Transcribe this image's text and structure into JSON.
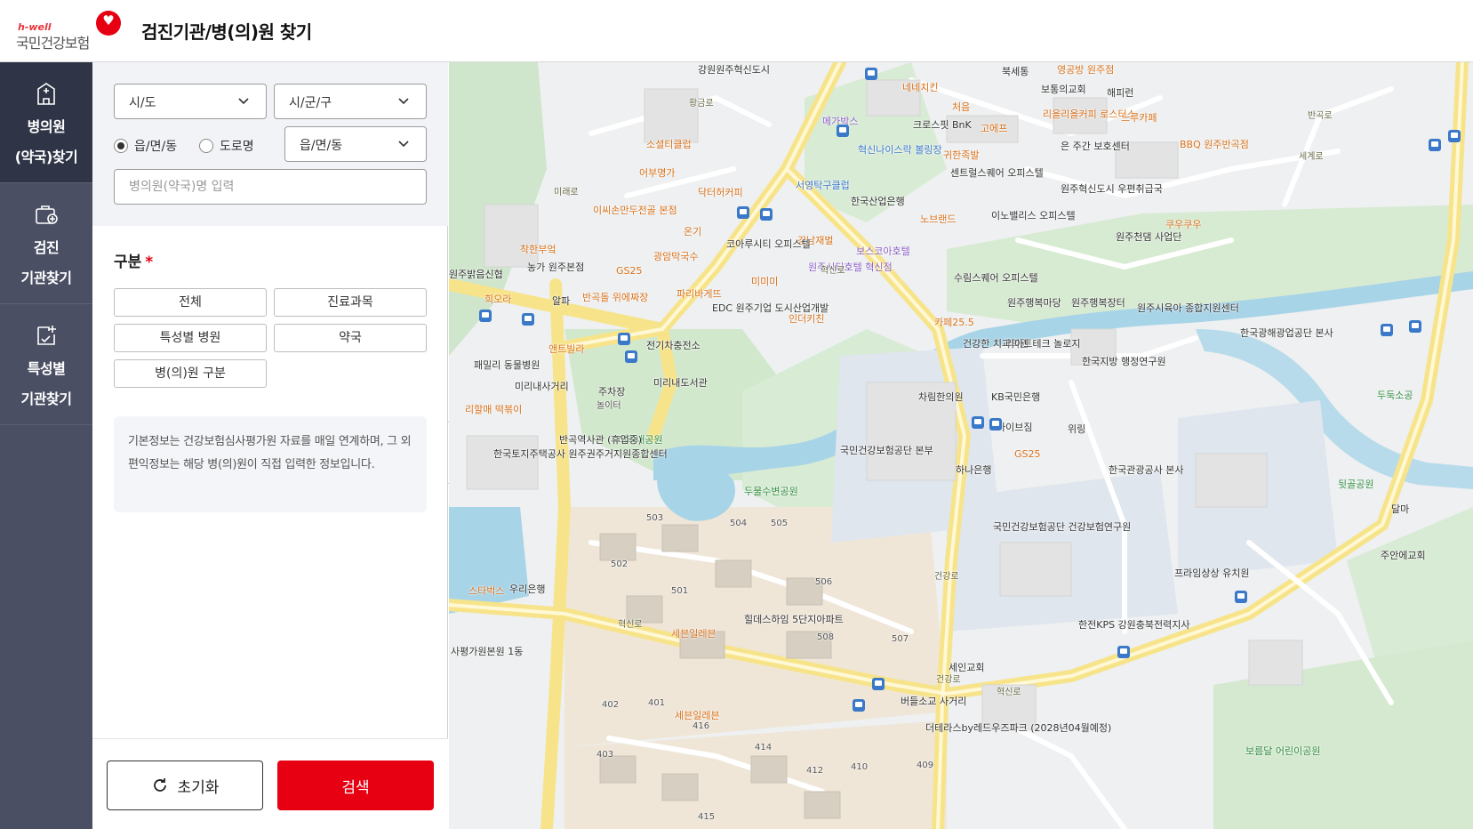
{
  "header": {
    "logo_small": "h-well",
    "logo_brand": "국민건강보험",
    "title": "검진기관/병(의)원 찾기"
  },
  "nav": {
    "items": [
      {
        "label": "병의원\n(약국)찾기",
        "icon": "hospital-icon",
        "active": true
      },
      {
        "label": "검진\n기관찾기",
        "icon": "medical-bag-icon",
        "active": false
      },
      {
        "label": "특성별\n기관찾기",
        "icon": "clipboard-plus-icon",
        "active": false
      }
    ]
  },
  "filters": {
    "sido": "시/도",
    "sigungu": "시/군/구",
    "radio_dong": "읍/면/동",
    "radio_road": "도로명",
    "dong_select": "읍/면/동",
    "name_placeholder": "병의원(약국)명 입력"
  },
  "category": {
    "title": "구분",
    "required_mark": "*",
    "buttons": [
      "전체",
      "진료과목",
      "특성별 병원",
      "약국",
      "병(의)원 구분"
    ]
  },
  "info_text": "기본정보는 건강보험심사평가원 자료를 매일 연계하며, 그 외 편익정보는 해당 병(의)원이 직접 입력한 정보입니다.",
  "actions": {
    "reset": "초기화",
    "search": "검색"
  },
  "map": {
    "labels": [
      {
        "t": "강원원주혁신도시",
        "c": "poi"
      },
      {
        "t": "북세통",
        "c": "poi"
      },
      {
        "t": "영공방 원주점",
        "c": "poi orange"
      },
      {
        "t": "보통의교회",
        "c": "poi"
      },
      {
        "t": "해피런",
        "c": "poi"
      },
      {
        "t": "네네치킨",
        "c": "poi orange"
      },
      {
        "t": "처음",
        "c": "poi orange"
      },
      {
        "t": "메가박스",
        "c": "poi purple"
      },
      {
        "t": "크로스핏 BnK",
        "c": "poi"
      },
      {
        "t": "고에프",
        "c": "poi orange"
      },
      {
        "t": "리을리을커피 로스터스",
        "c": "poi orange"
      },
      {
        "t": "느루카페",
        "c": "poi orange"
      },
      {
        "t": "BBQ 원주반곡점",
        "c": "poi orange"
      },
      {
        "t": "소셜티클럽",
        "c": "poi orange"
      },
      {
        "t": "혁신나이스락 볼링장",
        "c": "poi blue"
      },
      {
        "t": "귀한족발",
        "c": "poi orange"
      },
      {
        "t": "은 주간 보호센터",
        "c": "poi"
      },
      {
        "t": "어부명가",
        "c": "poi orange"
      },
      {
        "t": "닥터허커피",
        "c": "poi orange"
      },
      {
        "t": "서영탁구클럽",
        "c": "poi blue"
      },
      {
        "t": "센트럴스퀘어 오피스텔",
        "c": "poi"
      },
      {
        "t": "원주혁신도시 우편취급국",
        "c": "poi"
      },
      {
        "t": "이씨손만두전골 본점",
        "c": "poi orange"
      },
      {
        "t": "한국산업은행",
        "c": "poi"
      },
      {
        "t": "노브랜드",
        "c": "poi orange"
      },
      {
        "t": "이노밸리스 오피스텔",
        "c": "poi"
      },
      {
        "t": "쿠우쿠우",
        "c": "poi orange"
      },
      {
        "t": "온기",
        "c": "poi orange"
      },
      {
        "t": "강남재벌",
        "c": "poi orange"
      },
      {
        "t": "원주천댐 사업단",
        "c": "poi"
      },
      {
        "t": "착한부엌",
        "c": "poi orange"
      },
      {
        "t": "코아루시티 오피스텔",
        "c": "poi"
      },
      {
        "t": "보스코아호텔",
        "c": "poi purple"
      },
      {
        "t": "광암막국수",
        "c": "poi orange"
      },
      {
        "t": "원주시티호텔 혁신점",
        "c": "poi purple"
      },
      {
        "t": "원주밝음신협",
        "c": "poi"
      },
      {
        "t": "농가 원주본점",
        "c": "poi"
      },
      {
        "t": "GS25",
        "c": "poi orange"
      },
      {
        "t": "미미미",
        "c": "poi orange"
      },
      {
        "t": "수림스퀘어 오피스텔",
        "c": "poi"
      },
      {
        "t": "희오라",
        "c": "poi orange"
      },
      {
        "t": "알파",
        "c": "poi"
      },
      {
        "t": "반곡돌 위에짜장",
        "c": "poi orange"
      },
      {
        "t": "파리바게뜨",
        "c": "poi orange"
      },
      {
        "t": "원주행복마당",
        "c": "poi"
      },
      {
        "t": "원주행복장터",
        "c": "poi"
      },
      {
        "t": "원주시육아 종합지원센터",
        "c": "poi"
      },
      {
        "t": "EDC 원주기업 도시산업개발",
        "c": "poi"
      },
      {
        "t": "인더키친",
        "c": "poi orange"
      },
      {
        "t": "카페25.5",
        "c": "poi orange"
      },
      {
        "t": "한국광해광업공단 본사",
        "c": "poi"
      },
      {
        "t": "앤트빌라",
        "c": "poi orange"
      },
      {
        "t": "전기차충전소",
        "c": "poi"
      },
      {
        "t": "건강한 치과의원",
        "c": "poi"
      },
      {
        "t": "리아트테크 놀로지",
        "c": "poi"
      },
      {
        "t": "한국지방 행정연구원",
        "c": "poi"
      },
      {
        "t": "패밀리 동물병원",
        "c": "poi"
      },
      {
        "t": "미리내사거리",
        "c": "poi"
      },
      {
        "t": "주차장",
        "c": "poi"
      },
      {
        "t": "미리내도서관",
        "c": "poi"
      },
      {
        "t": "놀이터",
        "c": "poi num"
      },
      {
        "t": "차림한의원",
        "c": "poi"
      },
      {
        "t": "KB국민은행",
        "c": "poi"
      },
      {
        "t": "두둑소공",
        "c": "poi green"
      },
      {
        "t": "리할매 떡볶이",
        "c": "poi orange"
      },
      {
        "t": "바이브짐",
        "c": "poi"
      },
      {
        "t": "위링",
        "c": "poi"
      },
      {
        "t": "미리내공원",
        "c": "poi green"
      },
      {
        "t": "반곡역사관 (휴업중)",
        "c": "poi"
      },
      {
        "t": "국민건강보험공단 본부",
        "c": "poi"
      },
      {
        "t": "GS25",
        "c": "poi orange"
      },
      {
        "t": "한국토지주택공사 원주권주거지원종합센터",
        "c": "poi"
      },
      {
        "t": "하나은행",
        "c": "poi"
      },
      {
        "t": "한국관광공사 본사",
        "c": "poi"
      },
      {
        "t": "뒷골공원",
        "c": "poi green"
      },
      {
        "t": "두물수변공원",
        "c": "poi green"
      },
      {
        "t": "달마",
        "c": "poi"
      },
      {
        "t": "503",
        "c": "poi num"
      },
      {
        "t": "504",
        "c": "poi num"
      },
      {
        "t": "505",
        "c": "poi num"
      },
      {
        "t": "국민건강보험공단 건강보험연구원",
        "c": "poi"
      },
      {
        "t": "주안에교회",
        "c": "poi"
      },
      {
        "t": "502",
        "c": "poi num"
      },
      {
        "t": "506",
        "c": "poi num"
      },
      {
        "t": "프라임상상 유치원",
        "c": "poi"
      },
      {
        "t": "스타벅스",
        "c": "poi orange"
      },
      {
        "t": "우리은행",
        "c": "poi"
      },
      {
        "t": "501",
        "c": "poi num"
      },
      {
        "t": "힐데스하임 5단지아파트",
        "c": "poi"
      },
      {
        "t": "한전KPS 강원충북전력지사",
        "c": "poi"
      },
      {
        "t": "세븐일레븐",
        "c": "poi orange"
      },
      {
        "t": "508",
        "c": "poi num"
      },
      {
        "t": "507",
        "c": "poi num"
      },
      {
        "t": "사평가원본원 1동",
        "c": "poi"
      },
      {
        "t": "세인교회",
        "c": "poi"
      },
      {
        "t": "402",
        "c": "poi num"
      },
      {
        "t": "401",
        "c": "poi num"
      },
      {
        "t": "세븐일레븐",
        "c": "poi orange"
      },
      {
        "t": "416",
        "c": "poi num"
      },
      {
        "t": "버들소교 사거리",
        "c": "poi"
      },
      {
        "t": "더테라스by레드우즈파크 (2028년04월예정)",
        "c": "poi"
      },
      {
        "t": "414",
        "c": "poi num"
      },
      {
        "t": "403",
        "c": "poi num"
      },
      {
        "t": "412",
        "c": "poi num"
      },
      {
        "t": "410",
        "c": "poi num"
      },
      {
        "t": "409",
        "c": "poi num"
      },
      {
        "t": "보름달 어린이공원",
        "c": "poi green"
      },
      {
        "t": "415",
        "c": "poi num"
      },
      {
        "t": "혁신로",
        "c": "poi road"
      },
      {
        "t": "혁신로",
        "c": "poi road"
      },
      {
        "t": "혁신로",
        "c": "poi road"
      },
      {
        "t": "건강로",
        "c": "poi road"
      },
      {
        "t": "건강로",
        "c": "poi road"
      },
      {
        "t": "황금로",
        "c": "poi road"
      },
      {
        "t": "세계로",
        "c": "poi road"
      },
      {
        "t": "반곡로",
        "c": "poi road"
      },
      {
        "t": "미래로",
        "c": "poi road"
      }
    ]
  }
}
